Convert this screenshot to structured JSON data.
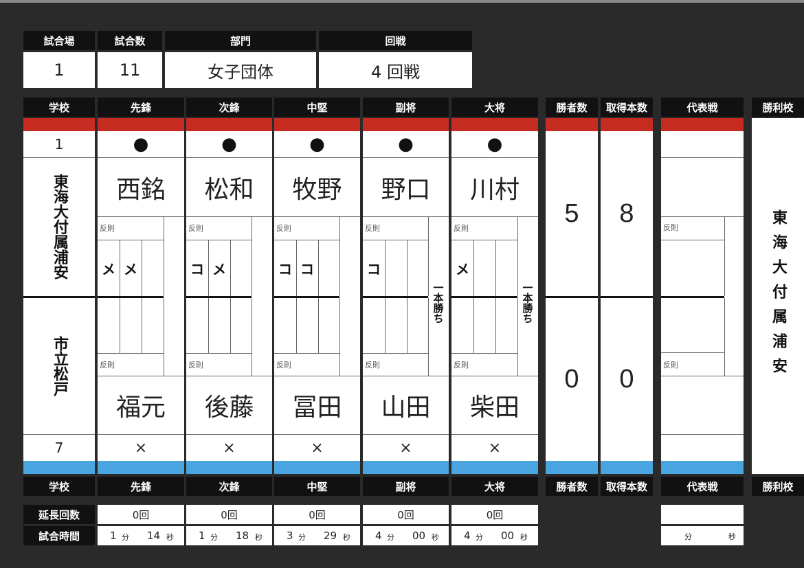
{
  "meta": {
    "headers": {
      "court": "試合場",
      "match_no": "試合数",
      "division": "部門",
      "round": "回戦"
    },
    "values": {
      "court": "1",
      "match_no": "11",
      "division": "女子団体",
      "round": "4 回戦"
    }
  },
  "columns": {
    "school": "学校",
    "positions": [
      "先鋒",
      "次鋒",
      "中堅",
      "副将",
      "大将"
    ],
    "winners": "勝者数",
    "points": "取得本数",
    "rep": "代表戦",
    "winner_school": "勝利校"
  },
  "team_red": {
    "number": "1",
    "name": "東海大付属浦安",
    "win_mark": "●",
    "players": [
      "西銘",
      "松和",
      "牧野",
      "野口",
      "川村"
    ],
    "waza": [
      [
        "メ",
        "メ",
        ""
      ],
      [
        "コ",
        "メ",
        ""
      ],
      [
        "コ",
        "コ",
        ""
      ],
      [
        "コ",
        "",
        ""
      ],
      [
        "メ",
        "",
        ""
      ]
    ],
    "winners": "5",
    "points": "8"
  },
  "team_blue": {
    "number": "7",
    "name": "市立松戸",
    "lose_mark": "×",
    "players": [
      "福元",
      "後藤",
      "冨田",
      "山田",
      "柴田"
    ],
    "winners": "0",
    "points": "0"
  },
  "hansoku_label": "反則",
  "ippon_label": "一本勝ち",
  "winner_school": "東海大付属浦安",
  "footer": {
    "overtime_label": "延長回数",
    "time_label": "試合時間",
    "overtime": [
      "0回",
      "0回",
      "0回",
      "0回",
      "0回"
    ],
    "times": [
      {
        "min": "1",
        "sec": "14"
      },
      {
        "min": "1",
        "sec": "18"
      },
      {
        "min": "3",
        "sec": "29"
      },
      {
        "min": "4",
        "sec": "00"
      },
      {
        "min": "4",
        "sec": "00"
      }
    ],
    "min_unit": "分",
    "sec_unit": "秒"
  }
}
